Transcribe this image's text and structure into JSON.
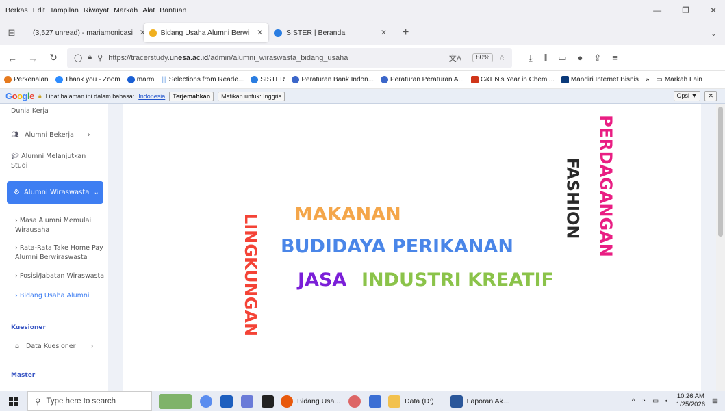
{
  "menu": [
    "Berkas",
    "Edit",
    "Tampilan",
    "Riwayat",
    "Markah",
    "Alat",
    "Bantuan"
  ],
  "tabs": [
    {
      "label": "(3,527 unread) - mariamonicasi",
      "icon_color": "#6b3fd4"
    },
    {
      "label": "Bidang Usaha Alumni Berwirasw",
      "icon_color": "#f0b020"
    },
    {
      "label": "SISTER | Beranda",
      "icon_color": "#2a7de1"
    }
  ],
  "url": {
    "prefix": "https://tracerstudy.",
    "host": "unesa.ac.id",
    "path": "/admin/alumni_wiraswasta_bidang_usaha"
  },
  "zoom": "80%",
  "bookmarks": [
    {
      "label": "Perkenalan",
      "color": "#e67a1e"
    },
    {
      "label": "Thank you - Zoom",
      "color": "#2d8cff"
    },
    {
      "label": "marm",
      "color": "#1a5fd4"
    },
    {
      "label": "Selections from Reade...",
      "color": "#1c6fd8"
    },
    {
      "label": "SISTER",
      "color": "#2a7de1"
    },
    {
      "label": "Peraturan Bank Indon...",
      "color": "#3b66c9"
    },
    {
      "label": "Peraturan Peraturan A...",
      "color": "#3b66c9"
    },
    {
      "label": "C&EN's Year in Chemi...",
      "color": "#d0361a"
    },
    {
      "label": "Mandiri Internet Bisnis",
      "color": "#0b3a7a"
    }
  ],
  "bookmarks_more": "Markah Lain",
  "translate": {
    "text": "Lihat halaman ini dalam bahasa:",
    "lang": "Indonesia",
    "translate_btn": "Terjemahkan",
    "off_btn": "Matikan untuk: Inggris",
    "options": "Opsi ▼"
  },
  "sidebar": {
    "top_label": "Dunia Kerja",
    "item_bekerja": "Alumni Bekerja",
    "item_melanjutkan": "Alumni Melanjutkan Studi",
    "item_wiraswasta": "Alumni Wiraswasta",
    "sub1": "Masa Alumni Memulai Wirausaha",
    "sub2": "Rata-Rata Take Home Pay Alumni Berwiraswasta",
    "sub3": "Posisi/Jabatan Wiraswasta",
    "sub4": "Bidang Usaha Alumni",
    "section_kuesioner": "Kuesioner",
    "item_data_kuesioner": "Data Kuesioner",
    "section_master": "Master"
  },
  "wordcloud": [
    {
      "text": "MAKANAN",
      "color": "#f4a64a"
    },
    {
      "text": "BUDIDAYA PERIKANAN",
      "color": "#4a86e8"
    },
    {
      "text": "JASA",
      "color": "#7b1fd8"
    },
    {
      "text": "INDUSTRI KREATIF",
      "color": "#8bc34a"
    },
    {
      "text": "LINGKUNGAN",
      "color": "#f44336"
    },
    {
      "text": "FASHION",
      "color": "#2a2a2a"
    },
    {
      "text": "PERDAGANGAN",
      "color": "#e91e83"
    }
  ],
  "taskbar": {
    "search": "Type here to search",
    "apps": [
      {
        "label": "Bidang Usa...",
        "color": "#e8590c"
      },
      {
        "label": "Data (D:)",
        "color": "#f2c14e"
      },
      {
        "label": "Laporan Ak...",
        "color": "#2b579a"
      }
    ],
    "time": "10:26 AM",
    "date": "1/25/2026"
  }
}
